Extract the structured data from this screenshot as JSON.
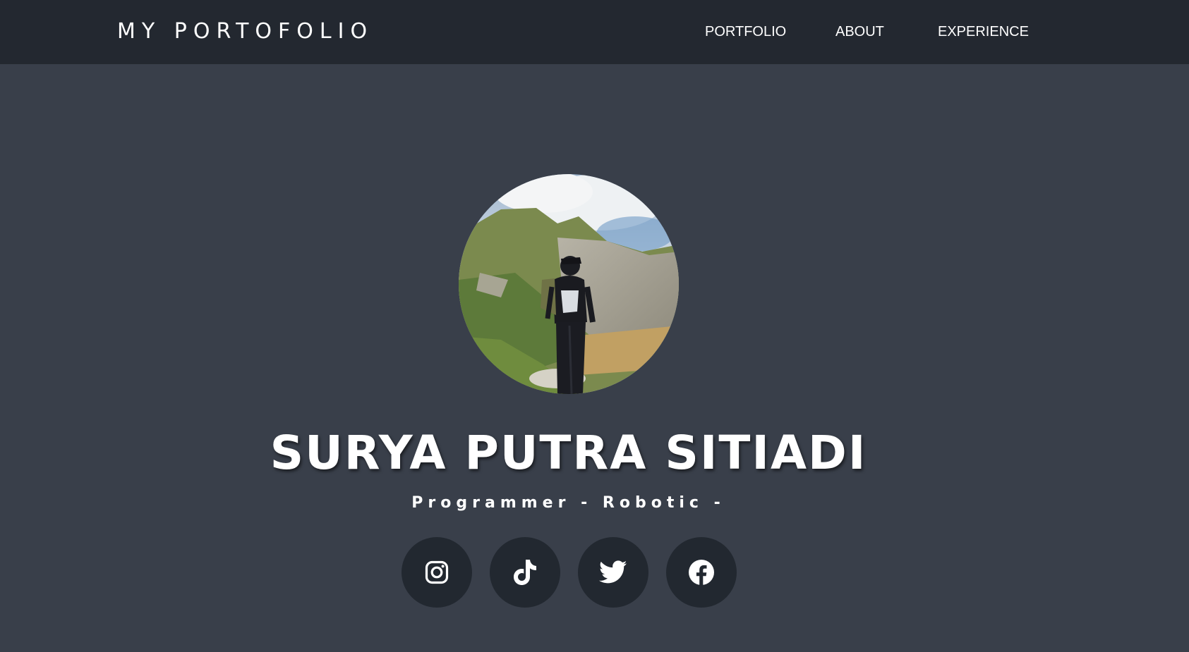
{
  "navbar": {
    "brand": "MY PORTOFOLIO",
    "links": [
      {
        "label": "PORTFOLIO"
      },
      {
        "label": "ABOUT"
      },
      {
        "label": "EXPERIENCE"
      }
    ]
  },
  "hero": {
    "name": "SURYA PUTRA SITIADI",
    "subtitle": "Programmer - Robotic -"
  },
  "social_links": [
    {
      "icon": "instagram-icon"
    },
    {
      "icon": "tiktok-icon"
    },
    {
      "icon": "twitter-icon"
    },
    {
      "icon": "facebook-icon"
    }
  ],
  "colors": {
    "page_background": "#393f4a",
    "navbar_background": "#232830",
    "social_button_background": "#222830",
    "text": "#ffffff"
  }
}
